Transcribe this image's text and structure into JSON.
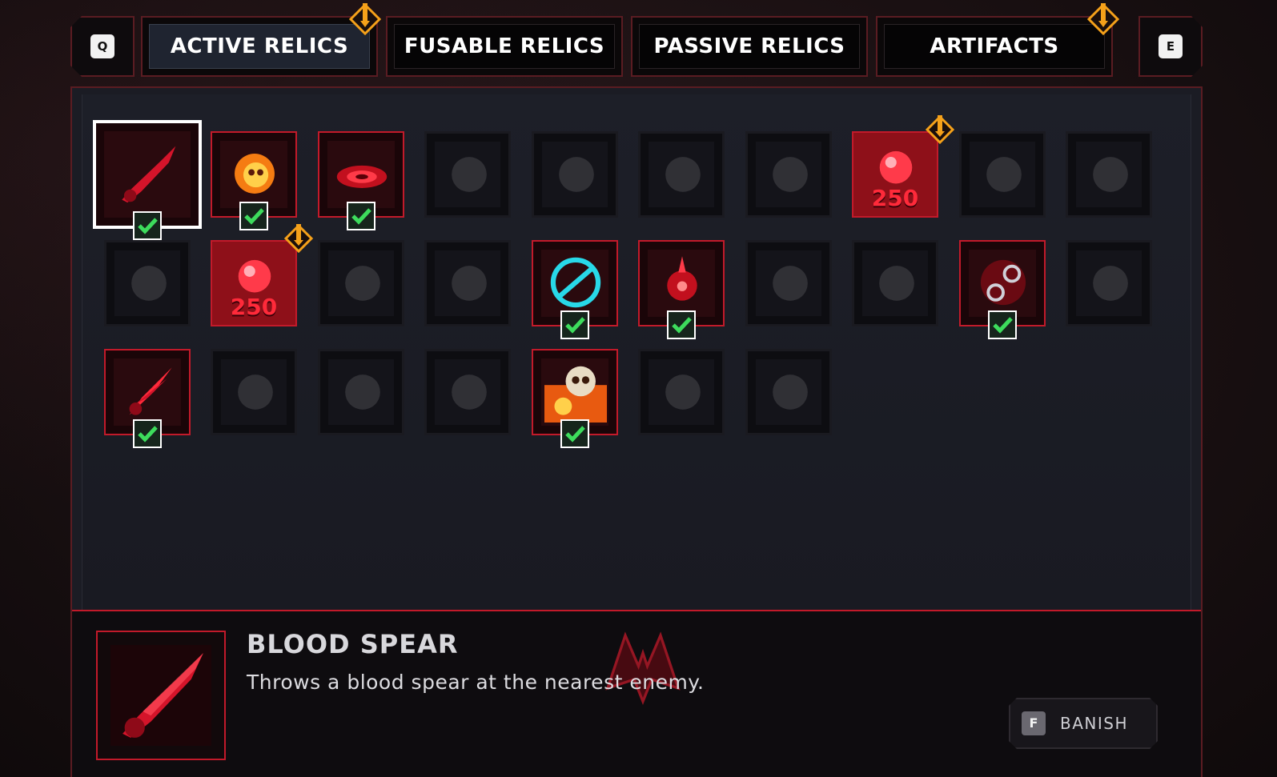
{
  "tabs": {
    "prev_key": "Q",
    "next_key": "E",
    "items": [
      {
        "label": "ACTIVE RELICS",
        "active": true,
        "alert": true
      },
      {
        "label": "FUSABLE RELICS",
        "active": false,
        "alert": false
      },
      {
        "label": "PASSIVE RELICS",
        "active": false,
        "alert": false
      },
      {
        "label": "ARTIFACTS",
        "active": false,
        "alert": true
      }
    ]
  },
  "relics": {
    "rows": [
      [
        {
          "state": "selected",
          "icon": "blood-spear-icon",
          "owned": true
        },
        {
          "state": "unlocked",
          "icon": "fire-skull-icon",
          "owned": true
        },
        {
          "state": "unlocked",
          "icon": "blood-vortex-icon",
          "owned": true
        },
        {
          "state": "locked",
          "icon": "moon-icon"
        },
        {
          "state": "locked",
          "icon": "beast-head-icon"
        },
        {
          "state": "locked",
          "icon": "black-hole-icon"
        },
        {
          "state": "locked",
          "icon": "shadow-beast-icon"
        },
        {
          "state": "shop",
          "icon": "blood-gem-icon",
          "price": "250",
          "alert": true
        },
        {
          "state": "locked",
          "icon": "bat-swarm-icon"
        },
        {
          "state": "locked",
          "icon": "wolf-head-icon"
        }
      ],
      [
        {
          "state": "locked",
          "icon": "claw-icon"
        },
        {
          "state": "shop",
          "icon": "blood-gem-icon",
          "price": "250",
          "alert": true
        },
        {
          "state": "locked",
          "icon": "lightning-crack-icon"
        },
        {
          "state": "locked",
          "icon": "spider-icon"
        },
        {
          "state": "unlocked",
          "icon": "cyan-rings-icon",
          "owned": true
        },
        {
          "state": "unlocked",
          "icon": "blood-demon-icon",
          "owned": true
        },
        {
          "state": "locked",
          "icon": "meteor-icon"
        },
        {
          "state": "locked",
          "icon": "whip-icon"
        },
        {
          "state": "unlocked",
          "icon": "chain-orbs-icon",
          "owned": true
        },
        {
          "state": "locked",
          "icon": "scythe-icon"
        }
      ],
      [
        {
          "state": "unlocked",
          "icon": "blood-burst-icon",
          "owned": true
        },
        {
          "state": "locked",
          "icon": "spiked-ball-icon"
        },
        {
          "state": "locked",
          "icon": "star-icon"
        },
        {
          "state": "locked",
          "icon": "storm-icon"
        },
        {
          "state": "unlocked",
          "icon": "fire-breath-skull-icon",
          "owned": true
        },
        {
          "state": "locked",
          "icon": "raven-icon"
        },
        {
          "state": "locked",
          "icon": "eye-orb-icon"
        }
      ]
    ]
  },
  "detail": {
    "title": "BLOOD SPEAR",
    "description": "Throws a blood spear at the nearest enemy.",
    "banish_key": "F",
    "banish_label": "BANISH"
  },
  "colors": {
    "frame_red": "#5a1c22",
    "accent_red": "#c21a2a",
    "alert_orange": "#f5a11a",
    "check_green": "#3ddc5c",
    "price_red": "#ff2a3a"
  }
}
